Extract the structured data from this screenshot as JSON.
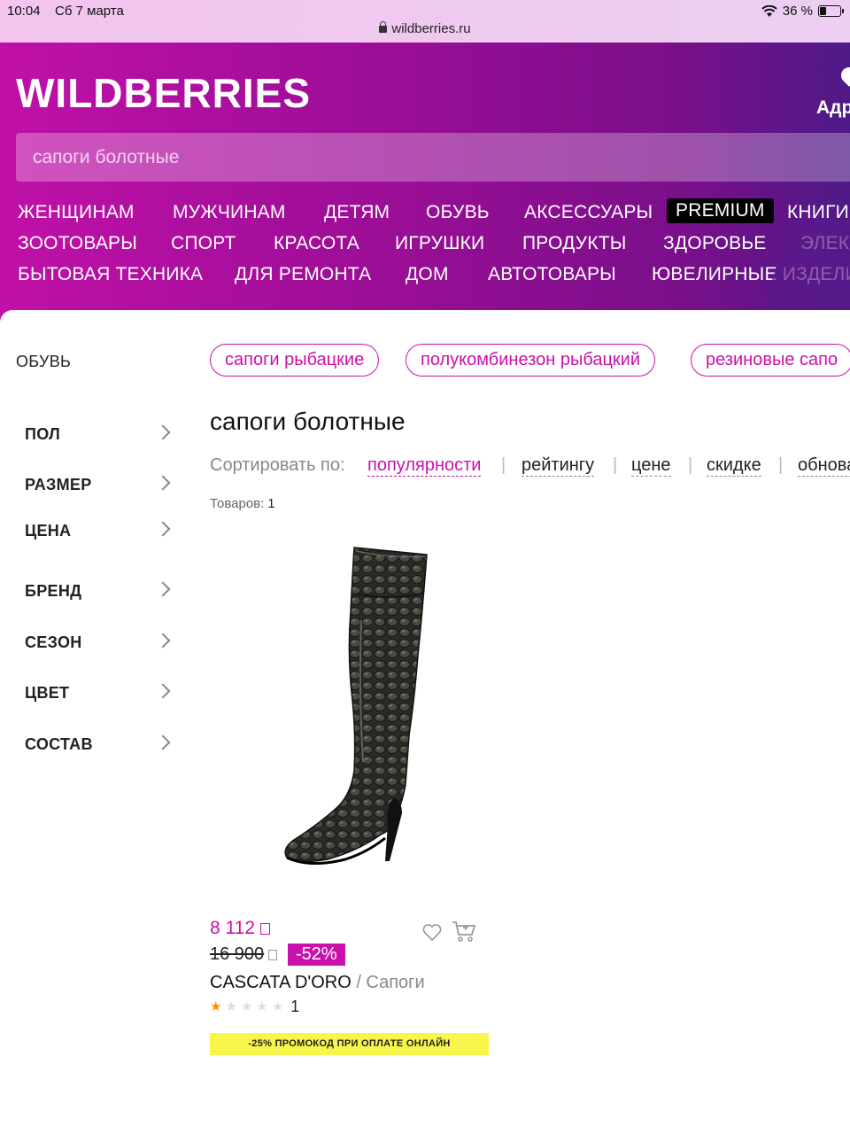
{
  "status_bar": {
    "time": "10:04",
    "date": "Сб 7 марта",
    "battery": "36 %",
    "url": "wildberries.ru"
  },
  "header": {
    "logo": "WILDBERRIES",
    "address_label": "Адр",
    "search_placeholder": "сапоги болотные",
    "nav_rows": [
      [
        "ЖЕНЩИНАМ",
        "МУЖЧИНАМ",
        "ДЕТЯМ",
        "ОБУВЬ",
        "АКСЕССУАРЫ",
        "PREMIUM",
        "КНИГИ"
      ],
      [
        "ЗООТОВАРЫ",
        "СПОРТ",
        "КРАСОТА",
        "ИГРУШКИ",
        "ПРОДУКТЫ",
        "ЗДОРОВЬЕ",
        "ЭЛЕКТ"
      ],
      [
        "БЫТОВАЯ ТЕХНИКА",
        "ДЛЯ РЕМОНТА",
        "ДОМ",
        "АВТОТОВАРЫ",
        "ЮВЕЛИРНЫЕ ИЗДЕЛИ"
      ]
    ]
  },
  "sidebar": {
    "breadcrumb": "ОБУВЬ",
    "filters": [
      "ПОЛ",
      "РАЗМЕР",
      "ЦЕНА",
      "БРЕНД",
      "СЕЗОН",
      "ЦВЕТ",
      "СОСТАВ"
    ]
  },
  "chips": [
    "сапоги рыбацкие",
    "полукомбинезон рыбацкий",
    "резиновые сапо"
  ],
  "main": {
    "title": "сапоги болотные",
    "sort_label": "Сортировать по:",
    "sort_options": [
      "популярности",
      "рейтингу",
      "цене",
      "скидке",
      "обнова"
    ],
    "count_label": "Товаров:",
    "count_value": "1"
  },
  "product": {
    "price": "8 112",
    "old_price": "16 900",
    "discount": "-52%",
    "brand": "CASCATA D'ORO",
    "category": " / Сапоги",
    "rating_stars": 1,
    "rating_count": "1",
    "promo": "-25% ПРОМОКОД ПРИ ОПЛАТЕ ОНЛАЙН"
  },
  "colors": {
    "brand": "#cb11ab",
    "promo": "#f8f64a"
  }
}
